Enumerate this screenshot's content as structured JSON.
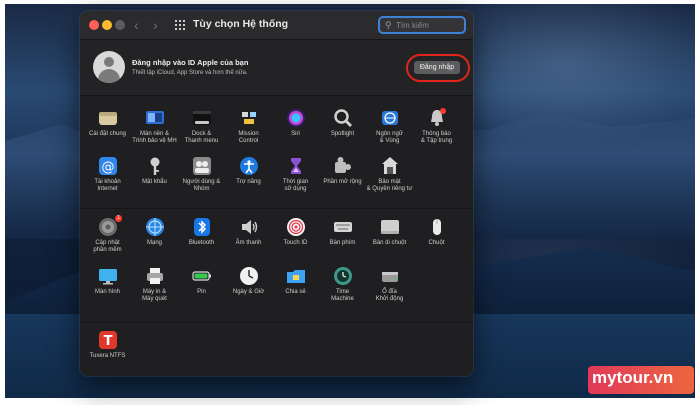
{
  "window": {
    "title": "Tùy chọn Hệ thống",
    "search_placeholder": "Tìm kiếm"
  },
  "account": {
    "title": "Đăng nhập vào ID Apple của bạn",
    "subtitle": "Thiết lập iCloud, App Store và hơn thế nữa.",
    "signin_label": "Đăng nhập"
  },
  "pane1": [
    {
      "label": "Cài đặt chung",
      "icon": "general-icon"
    },
    {
      "label": "Màn nền &\nTrình bảo vệ MH",
      "icon": "desktop-screensaver-icon"
    },
    {
      "label": "Dock &\nThanh menu",
      "icon": "dock-icon"
    },
    {
      "label": "Mission\nControl",
      "icon": "mission-control-icon"
    },
    {
      "label": "Siri",
      "icon": "siri-icon"
    },
    {
      "label": "Spotlight",
      "icon": "spotlight-icon"
    },
    {
      "label": "Ngôn ngữ\n& Vùng",
      "icon": "language-region-icon"
    },
    {
      "label": "Thông báo\n& Tập trung",
      "icon": "notifications-icon"
    },
    {
      "label": "Tài khoản\nInternet",
      "icon": "internet-accounts-icon"
    },
    {
      "label": "Mật khẩu",
      "icon": "passwords-icon"
    },
    {
      "label": "Người dùng &\nNhóm",
      "icon": "users-groups-icon"
    },
    {
      "label": "Trợ năng",
      "icon": "accessibility-icon"
    },
    {
      "label": "Thời gian\nsử dụng",
      "icon": "screen-time-icon"
    },
    {
      "label": "Phần mở rộng",
      "icon": "extensions-icon"
    },
    {
      "label": "Bảo mật\n& Quyền riêng tư",
      "icon": "security-privacy-icon"
    }
  ],
  "pane2": [
    {
      "label": "Cập nhật\nphần mềm",
      "icon": "software-update-icon"
    },
    {
      "label": "Mạng",
      "icon": "network-icon"
    },
    {
      "label": "Bluetooth",
      "icon": "bluetooth-icon"
    },
    {
      "label": "Âm thanh",
      "icon": "sound-icon"
    },
    {
      "label": "Touch ID",
      "icon": "touch-id-icon"
    },
    {
      "label": "Bàn phím",
      "icon": "keyboard-icon"
    },
    {
      "label": "Bàn di chuột",
      "icon": "trackpad-icon"
    },
    {
      "label": "Chuột",
      "icon": "mouse-icon"
    },
    {
      "label": "Màn hình",
      "icon": "displays-icon"
    },
    {
      "label": "Máy in &\nMáy quét",
      "icon": "printers-scanners-icon"
    },
    {
      "label": "Pin",
      "icon": "battery-icon"
    },
    {
      "label": "Ngày & Giờ",
      "icon": "date-time-icon"
    },
    {
      "label": "Chia sẻ",
      "icon": "sharing-icon"
    },
    {
      "label": "Time\nMachine",
      "icon": "time-machine-icon"
    },
    {
      "label": "Ổ đĩa\nKhởi động",
      "icon": "startup-disk-icon"
    }
  ],
  "pane3": [
    {
      "label": "Tuxera NTFS",
      "icon": "tuxera-ntfs-icon"
    }
  ],
  "badges": {
    "software_update_count": "1"
  },
  "watermark": {
    "text": "mytour.vn"
  },
  "colors": {
    "highlight_ring": "#e2241b",
    "search_focus": "#3d82d8",
    "traffic_red": "#fe5f57",
    "traffic_yellow": "#febc2e"
  }
}
